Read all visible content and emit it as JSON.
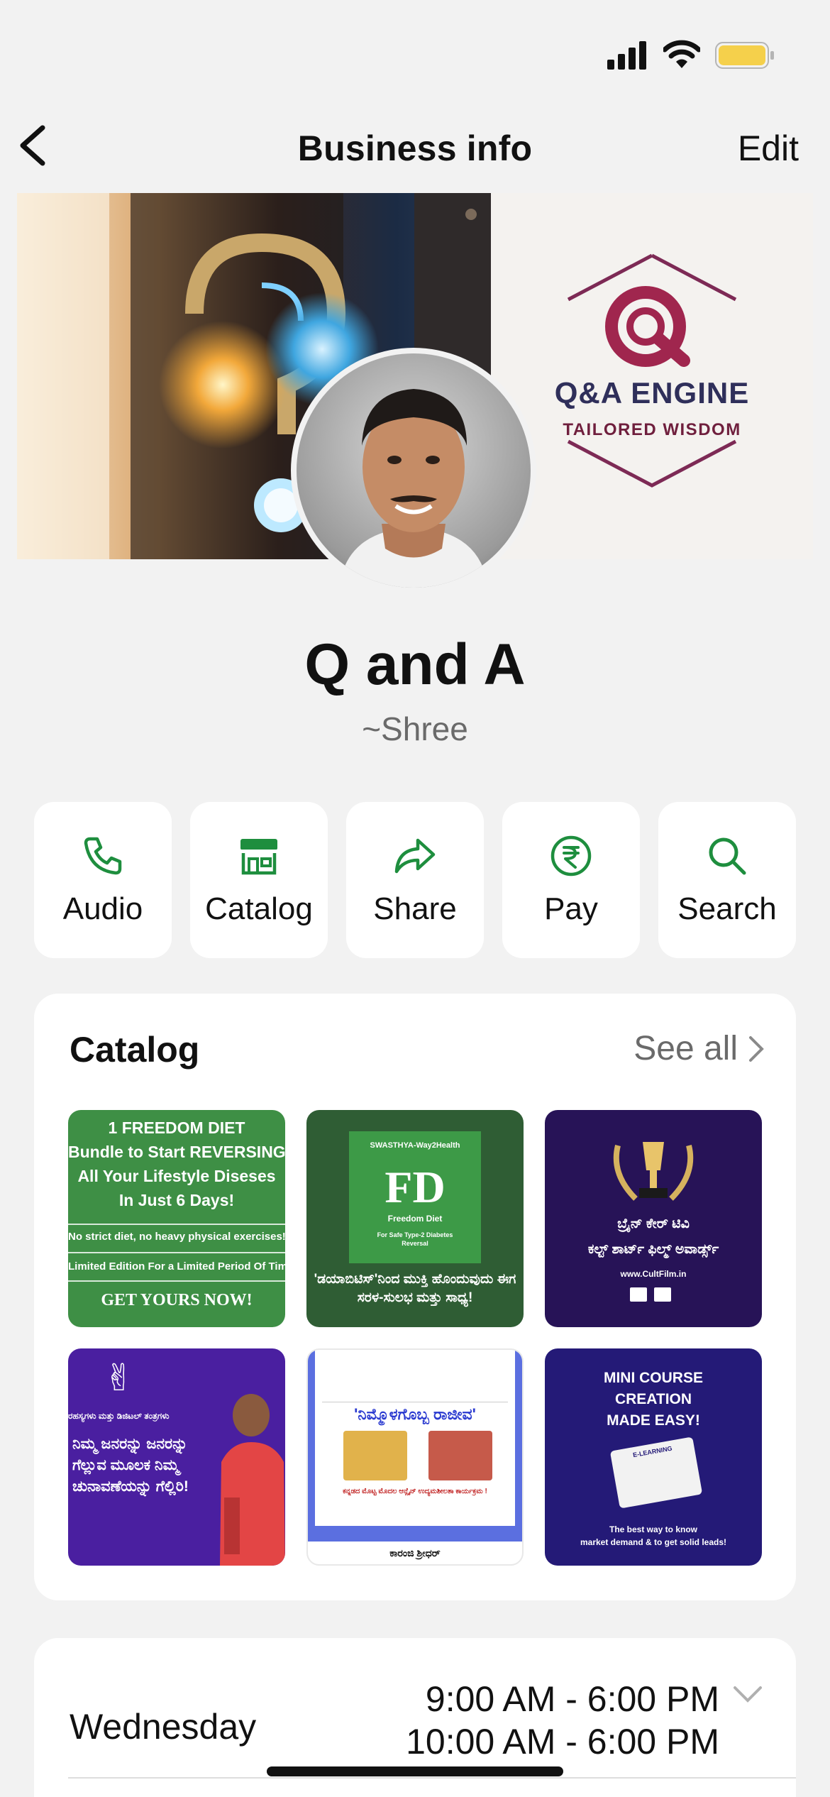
{
  "status_bar": {
    "signal_icon": "cellular-signal-icon",
    "wifi_icon": "wifi-icon",
    "battery_icon": "battery-icon",
    "battery_color": "#f5d04b"
  },
  "nav": {
    "back_icon": "chevron-left-icon",
    "title": "Business info",
    "edit_label": "Edit"
  },
  "cover": {
    "logo_title": "Q&A ENGINE",
    "logo_subtitle": "TAILORED WISDOM",
    "accent_color": "#a0264e"
  },
  "profile": {
    "name": "Q and A",
    "subtitle": "~Shree"
  },
  "actions": [
    {
      "label": "Audio",
      "icon": "phone-icon"
    },
    {
      "label": "Catalog",
      "icon": "storefront-icon"
    },
    {
      "label": "Share",
      "icon": "share-arrow-icon"
    },
    {
      "label": "Pay",
      "icon": "rupee-icon"
    },
    {
      "label": "Search",
      "icon": "search-icon"
    }
  ],
  "accent_green": "#1e8e3e",
  "catalog": {
    "title": "Catalog",
    "see_all": "See all",
    "items": [
      {
        "line1": "1 FREEDOM DIET",
        "line2": "Bundle to Start REVERSING",
        "line3": "All Your Lifestyle Diseses",
        "line4": "In Just 6 Days!",
        "line5": "No strict diet, no heavy physical exercises!",
        "line6": "Limited Edition For a Limited Period Of Time",
        "line7": "GET YOURS NOW!"
      },
      {
        "header": "SWASTHYA-Way2Health",
        "logo": "FD",
        "logo_sub": "Freedom Diet",
        "logo_sub2": "For Safe Type-2 Diabetes Reversal",
        "caption": "'ಡಯಾಬಿಟಿಸ್'ನಿಂದ ಮುಕ್ತಿ ಹೊಂದುವುದು ಈಗ ಸರಳ-ಸುಲಭ ಮತ್ತು ಸಾಧ್ಯ!"
      },
      {
        "line1": "ಬ್ರೈನ್ ಕೇರ್ ಟಿವಿ",
        "line2": "ಕಲ್ಟ್ ಶಾರ್ಟ್ ಫಿಲ್ಮ್ ಅವಾರ್ಡ್ಸ್",
        "line3": "www.CultFilm.in"
      },
      {
        "line1": "ರಹಸ್ಯಗಳು ಮತ್ತು ಡಿಜಿಟಲ್ ತಂತ್ರಗಳು",
        "line2": "ನಿಮ್ಮ ಜನರನ್ನು ಜನರನ್ನು ಗೆಲ್ಲುವ ಮೂಲಕ ನಿಮ್ಮ ಚುನಾವಣೆಯನ್ನು ಗೆಲ್ಲಿರಿ!"
      },
      {
        "title": "'ನಿಮ್ಮೊಳಗೊಬ್ಬ ರಾಜೀವ'",
        "line1": "ಕನ್ನಡದ ಮೊಟ್ಟ ಮೊದಲ ಆನ್ಲೈನ್ ಉದ್ಯಮಶೀಲತಾ ಕಾರ್ಯಕ್ರಮ !",
        "footer": "ಕಾರಂಜಿ ಶ್ರೀಧರ್"
      },
      {
        "line1": "MINI COURSE",
        "line2": "CREATION",
        "line3": "MADE EASY!",
        "device_label": "E-LEARNING",
        "line4": "The best way to know",
        "line5": "market demand & to get solid leads!"
      }
    ]
  },
  "hours": {
    "day": "Wednesday",
    "time1": "9:00 AM - 6:00 PM",
    "time2": "10:00 AM - 6:00 PM",
    "chevron_icon": "chevron-down-icon"
  }
}
